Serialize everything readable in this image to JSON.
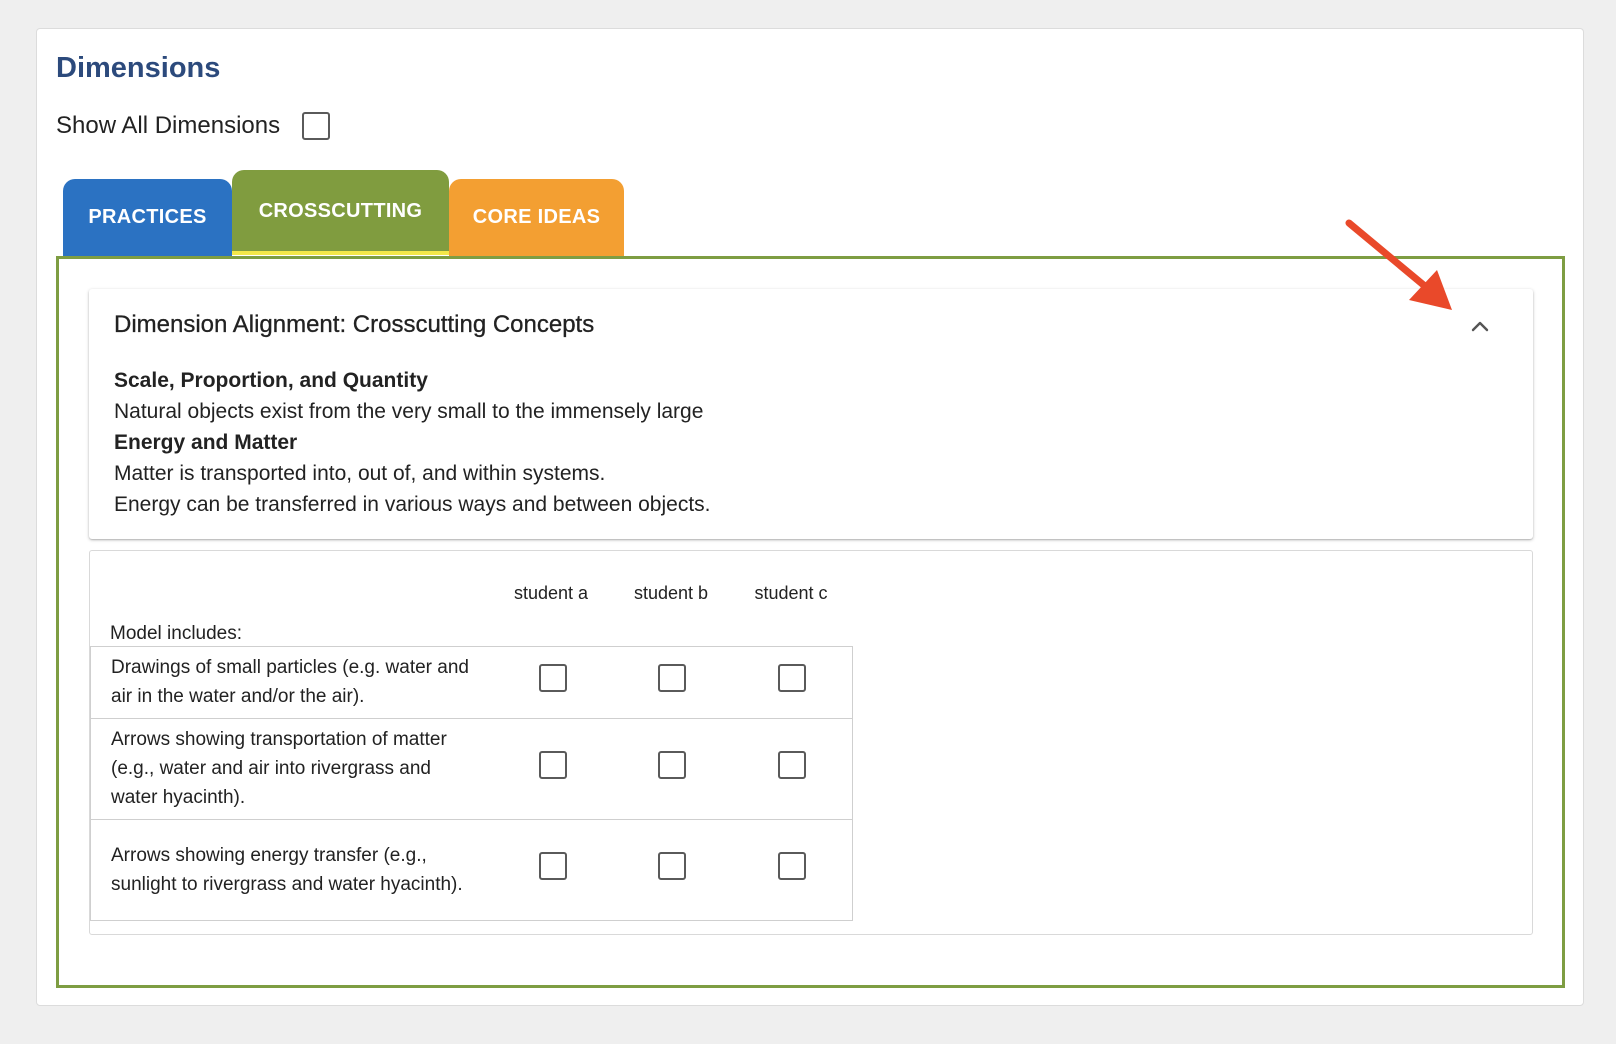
{
  "page": {
    "title": "Dimensions",
    "show_all_label": "Show All Dimensions"
  },
  "tabs": [
    {
      "label": "PRACTICES",
      "color": "#2b72c2"
    },
    {
      "label": "CROSSCUTTING",
      "color": "#809c3f",
      "active": true
    },
    {
      "label": "CORE IDEAS",
      "color": "#f39f32"
    }
  ],
  "alignment": {
    "title": "Dimension Alignment: Crosscutting Concepts",
    "sections": [
      {
        "heading": "Scale, Proportion, and Quantity",
        "lines": [
          "Natural objects exist from the very small to the immensely large"
        ]
      },
      {
        "heading": "Energy and Matter",
        "lines": [
          "Matter is transported into, out of, and within systems.",
          "Energy can be transferred in various ways and between objects."
        ]
      }
    ]
  },
  "rubric": {
    "columns": [
      "student a",
      "student b",
      "student c"
    ],
    "row_header": "Model includes:",
    "rows": [
      {
        "text": "Drawings of small particles (e.g. water and air in the water and/or the air)."
      },
      {
        "text": "Arrows showing transportation of matter (e.g., water and air into rivergrass and water hyacinth)."
      },
      {
        "text": "Arrows showing energy transfer (e.g., sunlight to rivergrass and water hyacinth)."
      }
    ]
  },
  "colors": {
    "title": "#2c4a7c",
    "panel_border": "#7e9d42",
    "active_tab_underline": "#f4e84a",
    "annotation_arrow": "#e9492a"
  },
  "icons": {
    "collapse": "chevron-up-icon",
    "annotation": "red-arrow-annotation"
  }
}
